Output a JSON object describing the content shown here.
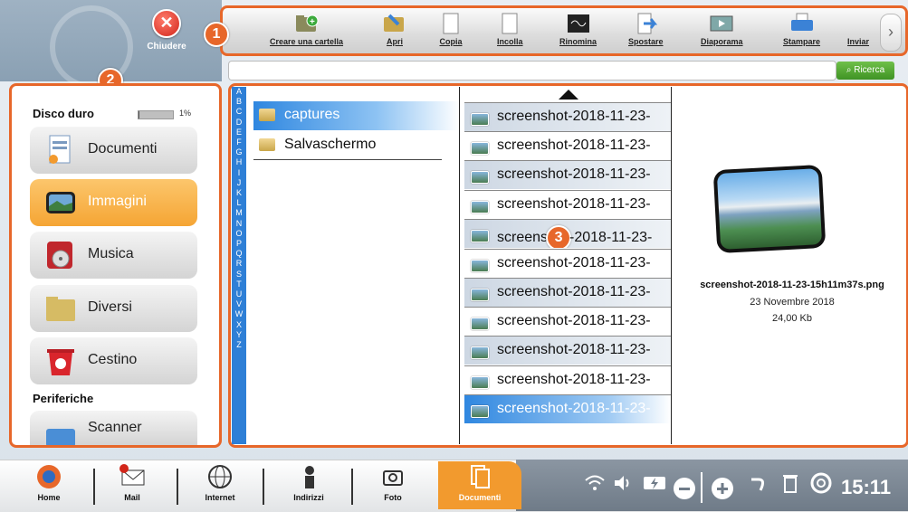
{
  "header": {
    "close_label": "Chiudere",
    "markers": {
      "m1": "1",
      "m2": "2",
      "m3": "3"
    }
  },
  "toolbar": {
    "items": [
      {
        "label": "Creare una cartella",
        "icon": "folder-add-icon"
      },
      {
        "label": "Apri",
        "icon": "open-folder-icon"
      },
      {
        "label": "Copia",
        "icon": "copy-icon"
      },
      {
        "label": "Incolla",
        "icon": "paste-icon"
      },
      {
        "label": "Rinomina",
        "icon": "rename-icon"
      },
      {
        "label": "Spostare",
        "icon": "move-icon"
      },
      {
        "label": "Diaporama",
        "icon": "slideshow-icon"
      },
      {
        "label": "Stampare",
        "icon": "printer-icon"
      },
      {
        "label": "Inviar",
        "icon": "send-icon"
      }
    ],
    "next": "›"
  },
  "search": {
    "placeholder": "",
    "button_label": "Ricerca"
  },
  "sidebar": {
    "disk_title": "Disco duro",
    "disk_usage_fraction": 0.01,
    "disk_usage_label": "1%",
    "categories": [
      {
        "label": "Documenti",
        "icon": "documents-icon",
        "active": false
      },
      {
        "label": "Immagini",
        "icon": "images-icon",
        "active": true
      },
      {
        "label": "Musica",
        "icon": "music-icon",
        "active": false
      },
      {
        "label": "Diversi",
        "icon": "folder-icon",
        "active": false
      },
      {
        "label": "Cestino",
        "icon": "trash-icon",
        "active": false
      }
    ],
    "peripherals_title": "Periferiche",
    "peripheral_item": "Scanner"
  },
  "alphabet": [
    "A",
    "B",
    "C",
    "D",
    "E",
    "F",
    "G",
    "H",
    "I",
    "J",
    "K",
    "L",
    "M",
    "N",
    "O",
    "P",
    "Q",
    "R",
    "S",
    "T",
    "U",
    "V",
    "W",
    "X",
    "Y",
    "Z"
  ],
  "folders": [
    {
      "label": "captures",
      "selected": true
    },
    {
      "label": "Salvaschermo",
      "selected": false
    }
  ],
  "files": [
    {
      "label": "screenshot-2018-11-23-",
      "selected": false
    },
    {
      "label": "screenshot-2018-11-23-",
      "selected": false
    },
    {
      "label": "screenshot-2018-11-23-",
      "selected": false
    },
    {
      "label": "screenshot-2018-11-23-",
      "selected": false
    },
    {
      "label": "screens",
      "label_tail": "-2018-11-23-",
      "selected": false
    },
    {
      "label": "screenshot-2018-11-23-",
      "selected": false
    },
    {
      "label": "screenshot-2018-11-23-",
      "selected": false
    },
    {
      "label": "screenshot-2018-11-23-",
      "selected": false
    },
    {
      "label": "screenshot-2018-11-23-",
      "selected": false
    },
    {
      "label": "screenshot-2018-11-23-",
      "selected": false
    },
    {
      "label": "screenshot-2018-11-23-",
      "selected": true
    }
  ],
  "preview": {
    "filename": "screenshot-2018-11-23-15h11m37s.png",
    "date": "23 Novembre 2018",
    "size": "24,00 Kb"
  },
  "taskbar": {
    "items": [
      {
        "label": "Home",
        "icon": "home-icon"
      },
      {
        "label": "Mail",
        "icon": "mail-icon"
      },
      {
        "label": "Internet",
        "icon": "globe-icon"
      },
      {
        "label": "Indirizzi",
        "icon": "contacts-icon"
      },
      {
        "label": "Foto",
        "icon": "camera-icon"
      },
      {
        "label": "Documenti",
        "icon": "documents-icon"
      }
    ],
    "clock": "15:11"
  },
  "colors": {
    "accent": "#e7672a",
    "selection": "#2f87e0",
    "active_category": "#f5a534"
  }
}
